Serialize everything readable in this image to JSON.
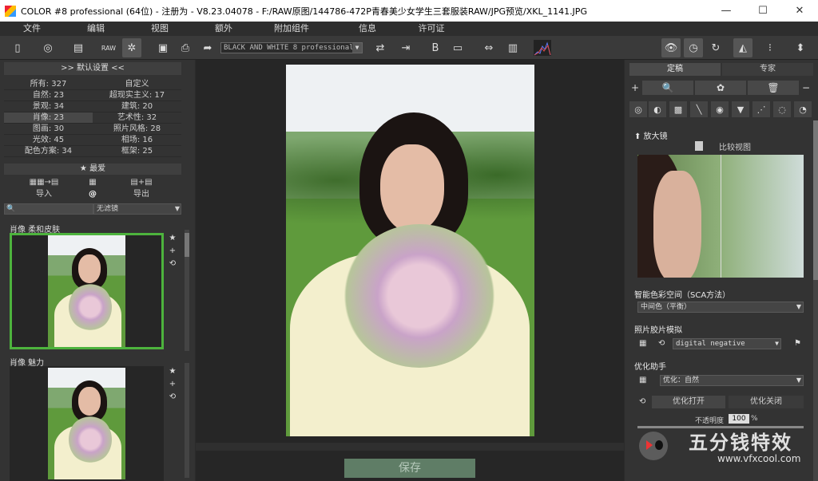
{
  "window": {
    "title": "COLOR #8 professional (64位) - 注册为 - V8.23.04078 - F:/RAW原图/144786-472P青春美少女学生三套服装RAW/JPG预览/XKL_1141.JPG",
    "minimize": "—",
    "maximize": "☐",
    "close": "✕"
  },
  "menu": [
    "文件",
    "编辑",
    "视图",
    "额外",
    "附加组件",
    "信息",
    "许可证"
  ],
  "toolbar": {
    "preset": "BLACK AND WHITE 8 professional"
  },
  "left_panel": {
    "header": ">> 默认设置 <<",
    "categories": [
      {
        "left": "所有: 327",
        "right": "自定义"
      },
      {
        "left": "自然: 23",
        "right": "超现实主义: 17"
      },
      {
        "left": "景观: 34",
        "right": "建筑: 20"
      },
      {
        "left": "肖像: 23",
        "right": "艺术性: 32"
      },
      {
        "left": "图画: 30",
        "right": "照片风格: 28"
      },
      {
        "left": "光效: 45",
        "right": "相场: 16"
      },
      {
        "left": "配色方案: 34",
        "right": "框架: 25"
      }
    ],
    "favorites": "★ 最爱",
    "import": "导入",
    "at": "@",
    "export": "导出",
    "filter_select": "无滤镜",
    "thumbs": [
      {
        "caption": "肖像 柔和皮肤"
      },
      {
        "caption": "肖像 魅力"
      }
    ]
  },
  "center": {
    "save": "保存"
  },
  "right_panel": {
    "tab_fine": "定稿",
    "tab_expert": "专家",
    "magnifier": "⬆ 放大镜",
    "compare": "比较视图",
    "sca_label": "智能色彩空间（SCA方法）",
    "sca_value": "中间色（平衡）",
    "film_label": "照片胶片模拟",
    "film_value": "digital negative",
    "opt_label": "优化助手",
    "opt_value": "优化：自然",
    "opt_on": "优化打开",
    "opt_off": "优化关闭",
    "opacity_label": "不透明度",
    "opacity_value": "100",
    "opacity_unit": "%"
  },
  "watermark": {
    "brand": "五分钱特效",
    "url": "www.vfxcool.com"
  },
  "colors": {
    "accent_green": "#4db33d",
    "save_button": "#5f7d66"
  }
}
